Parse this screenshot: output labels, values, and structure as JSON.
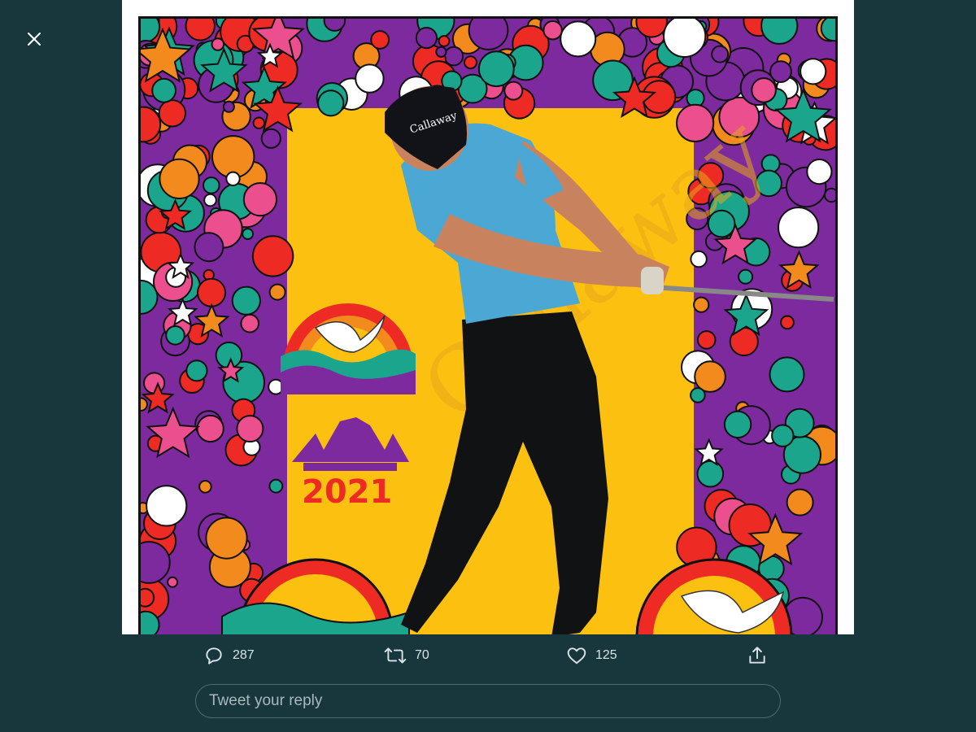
{
  "viewer": {
    "close_icon": "close-icon"
  },
  "poster": {
    "year_text": "2021",
    "cap_brand": "Callaway",
    "watermark": "Callaway",
    "colors": {
      "background": "#fcc010",
      "red": "#ee2a24",
      "purple": "#7d2a9e",
      "teal": "#1aa58c",
      "orange": "#f28a1e",
      "pink": "#ec4f8d",
      "shirt": "#4ba8d4",
      "pants": "#101214"
    }
  },
  "actions": {
    "reply": {
      "icon": "reply-icon",
      "count": "287"
    },
    "retweet": {
      "icon": "retweet-icon",
      "count": "70"
    },
    "like": {
      "icon": "heart-icon",
      "count": "125"
    },
    "share": {
      "icon": "share-icon"
    }
  },
  "reply_input": {
    "placeholder": "Tweet your reply"
  }
}
